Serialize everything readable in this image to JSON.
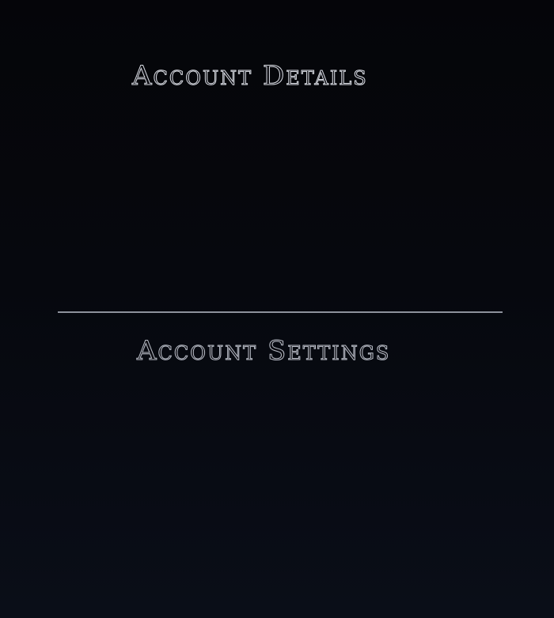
{
  "account_details": {
    "title": "Account Details"
  },
  "account_settings": {
    "title": "Account Settings"
  }
}
